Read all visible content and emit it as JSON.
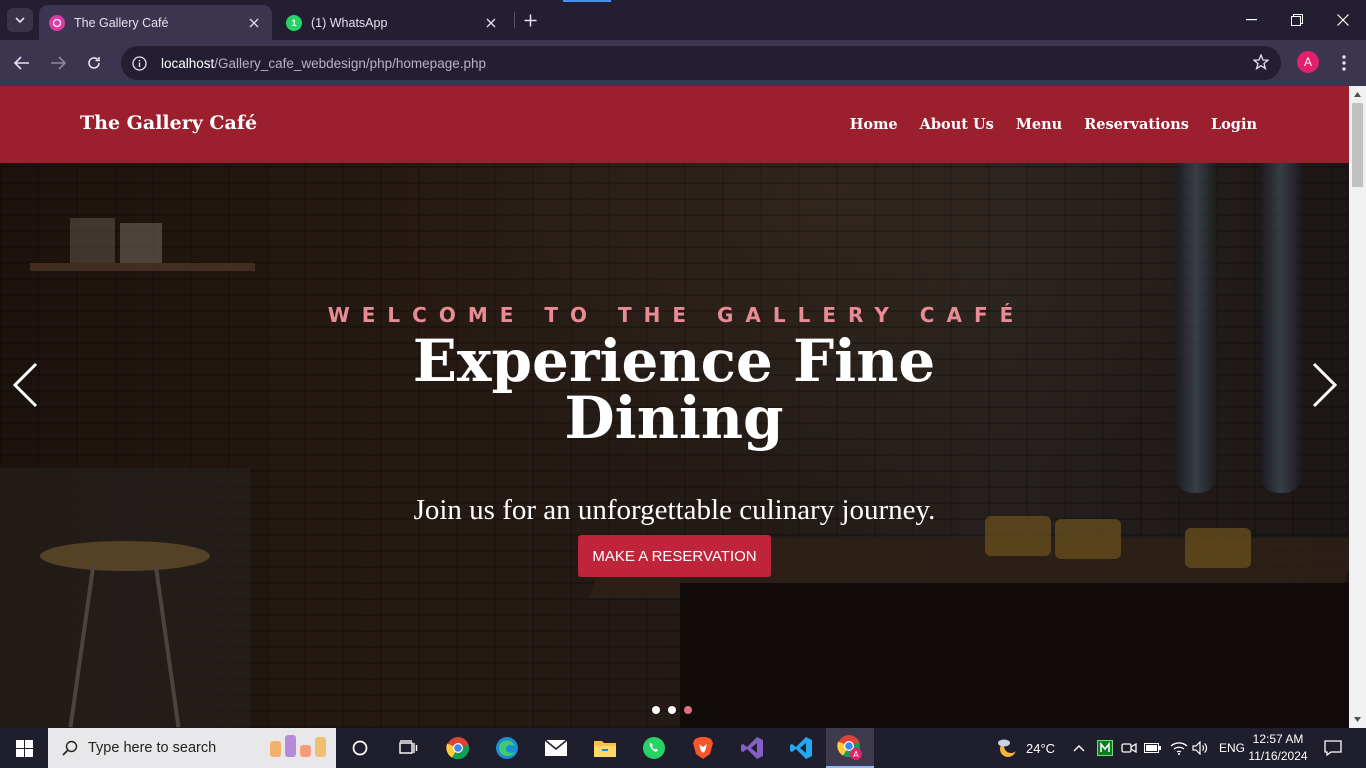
{
  "browser": {
    "tabs": [
      {
        "title": "The Gallery Café",
        "active": true
      },
      {
        "title": "(1) WhatsApp",
        "active": false
      }
    ],
    "url_host": "localhost",
    "url_path": "/Gallery_cafe_webdesign/php/homepage.php",
    "profile_initial": "A",
    "accent": "#9b1f2d"
  },
  "site": {
    "brand": "The Gallery Café",
    "nav": [
      "Home",
      "About Us",
      "Menu",
      "Reservations",
      "Login"
    ]
  },
  "hero": {
    "kicker": "WELCOME TO THE GALLERY CAFÉ",
    "headline": "Experience Fine Dining",
    "subhead": "Join us for an unforgettable culinary journey.",
    "cta": "MAKE A RESERVATION",
    "slides_total": 3,
    "active_slide": 3
  },
  "taskbar": {
    "search_placeholder": "Type here to search",
    "apps": [
      "task-view",
      "chrome",
      "edge",
      "mail",
      "file-explorer",
      "whatsapp",
      "brave",
      "visual-studio",
      "vscode",
      "chrome-profile"
    ],
    "weather": "24°C",
    "language": "ENG",
    "time": "12:57 AM",
    "date": "11/16/2024"
  }
}
